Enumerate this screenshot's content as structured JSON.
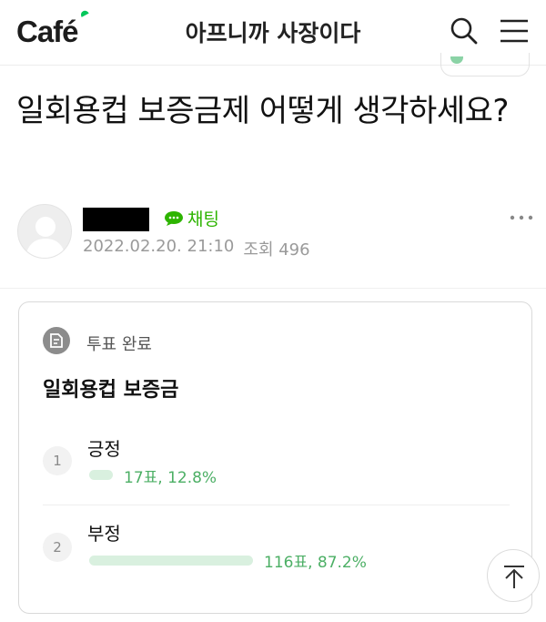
{
  "header": {
    "logo_text": "Café",
    "cafe_name": "아프니까 사장이다",
    "search_icon": "search-icon",
    "menu_icon": "hamburger-menu-icon",
    "brand_color": "#03c75a"
  },
  "post": {
    "title": "일회용컵 보증금제 어떻게 생각하세요?",
    "author": {
      "avatar_icon": "default-avatar-icon",
      "chat_label": "채팅",
      "chat_icon": "chat-bubble-icon"
    },
    "date": "2022.02.20. 21:10",
    "views_label": "조회 496",
    "more_icon": "more-options-icon"
  },
  "vote": {
    "status_icon": "vote-document-icon",
    "status": "투표 완료",
    "question": "일회용컵 보증금",
    "accent_color": "#4caf65",
    "options": [
      {
        "number": "1",
        "label": "긍정",
        "result": "17표, 12.8%",
        "percent": 12.8
      },
      {
        "number": "2",
        "label": "부정",
        "result": "116표, 87.2%",
        "percent": 87.2
      }
    ]
  },
  "scroll_top_icon": "arrow-up-icon"
}
